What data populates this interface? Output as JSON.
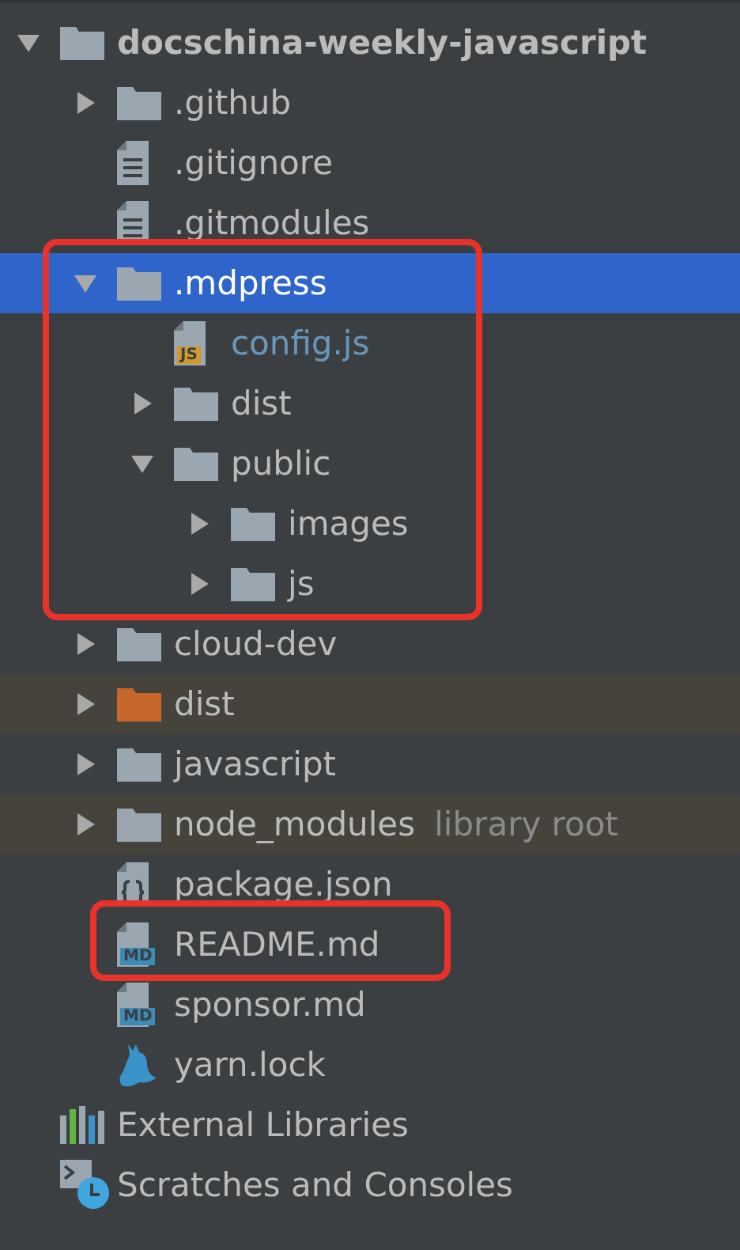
{
  "tree": [
    {
      "name": "docschina-weekly-javascript",
      "kind": "folder",
      "expanded": true,
      "bold": true,
      "selected": false,
      "children": [
        {
          "name": ".github",
          "kind": "folder",
          "expanded": false,
          "selected": false
        },
        {
          "name": ".gitignore",
          "kind": "text-file",
          "selected": false
        },
        {
          "name": ".gitmodules",
          "kind": "text-file",
          "selected": false
        },
        {
          "name": ".mdpress",
          "kind": "folder",
          "expanded": true,
          "selected": true,
          "outlined": true,
          "children": [
            {
              "name": "config.js",
              "kind": "badge-file",
              "badge": "JS",
              "color": "#d09a2e",
              "modified": true,
              "selected": false
            },
            {
              "name": "dist",
              "kind": "folder",
              "expanded": false,
              "selected": false
            },
            {
              "name": "public",
              "kind": "folder",
              "expanded": true,
              "selected": false,
              "children": [
                {
                  "name": "images",
                  "kind": "folder",
                  "expanded": false,
                  "selected": false
                },
                {
                  "name": "js",
                  "kind": "folder",
                  "expanded": false,
                  "selected": false
                }
              ]
            }
          ]
        },
        {
          "name": "cloud-dev",
          "kind": "folder",
          "expanded": false,
          "selected": false
        },
        {
          "name": "dist",
          "kind": "folder",
          "expanded": false,
          "excluded": true,
          "selected": false
        },
        {
          "name": "javascript",
          "kind": "folder",
          "expanded": false,
          "selected": false
        },
        {
          "name": "node_modules",
          "kind": "folder",
          "expanded": false,
          "library": true,
          "note": "library root",
          "selected": false
        },
        {
          "name": "package.json",
          "kind": "json-file",
          "selected": false
        },
        {
          "name": "README.md",
          "kind": "badge-file",
          "badge": "MD",
          "color": "#3c8cb8",
          "outlined": true,
          "selected": false
        },
        {
          "name": "sponsor.md",
          "kind": "badge-file",
          "badge": "MD",
          "color": "#3c8cb8",
          "selected": false
        },
        {
          "name": "yarn.lock",
          "kind": "yarn-file",
          "selected": false
        }
      ]
    },
    {
      "name": "External Libraries",
      "kind": "libraries",
      "selected": false
    },
    {
      "name": "Scratches and Consoles",
      "kind": "scratches",
      "selected": false
    }
  ]
}
